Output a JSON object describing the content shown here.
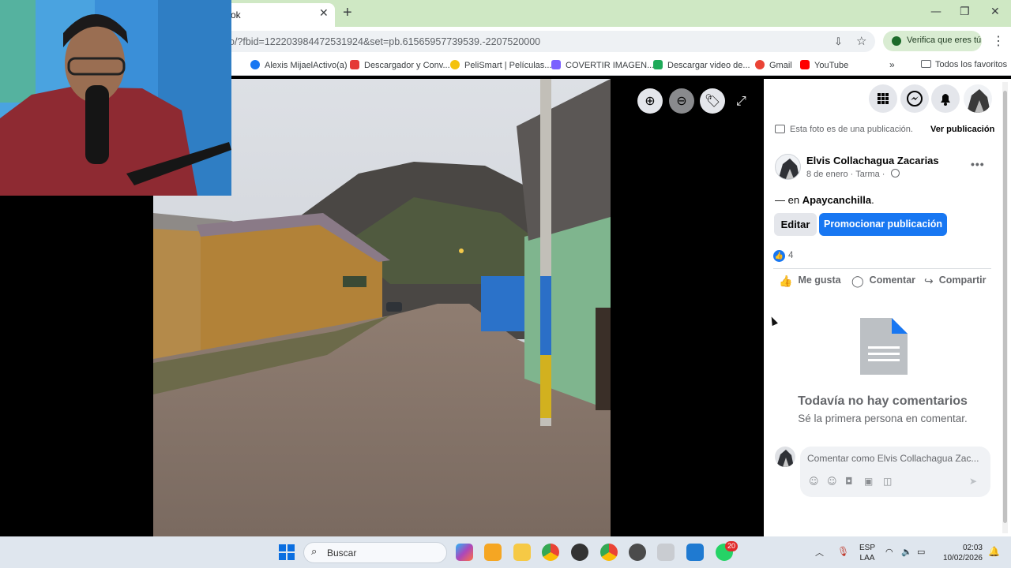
{
  "browser": {
    "tab_title": "ok",
    "tab_close": "✕",
    "new_tab": "+",
    "window_controls": [
      "—",
      "❐",
      "✕"
    ],
    "url": "o/?fbid=122203984472531924&set=pb.61565957739539.-2207520000",
    "verify_chip": "Verifica que eres tú",
    "menu": "⋮",
    "more_bookmarks": "»",
    "all_bookmarks": "Todos los favoritos",
    "bookmarks": [
      {
        "label": "Alexis MijaelActivo(a)",
        "color": "#1877f2"
      },
      {
        "label": "Descargador y Conv...",
        "color": "#e53935"
      },
      {
        "label": "PeliSmart | Películas...",
        "color": "#f4c20d"
      },
      {
        "label": "COVERTIR IMAGEN...",
        "color": "#7b61ff"
      },
      {
        "label": "Descargar video de...",
        "color": "#1faa59"
      },
      {
        "label": "Gmail",
        "color": "#ea4335"
      },
      {
        "label": "YouTube",
        "color": "#ff0000"
      }
    ]
  },
  "viewer": {
    "zoom_in": "⊕",
    "zoom_out": "⊖",
    "tag": "🏷",
    "expand": "⤢"
  },
  "post": {
    "info": "Esta foto es de una publicación.",
    "view_post": "Ver publicación",
    "author": "Elvis Collachagua Zacarias",
    "date": "8 de enero",
    "place_meta": "Tarma",
    "location_prefix": "— en ",
    "location": "Apaycanchilla",
    "location_suffix": ".",
    "edit": "Editar",
    "promote": "Promocionar publicación",
    "like_count": "4",
    "actions": {
      "like": "Me gusta",
      "comment": "Comentar",
      "share": "Compartir"
    },
    "no_comments": "Todavía no hay comentarios",
    "be_first": "Sé la primera persona en comentar.",
    "comment_placeholder": "Comentar como Elvis Collachagua Zac..."
  },
  "taskbar": {
    "search": "Buscar",
    "whatsapp_badge": "20",
    "lang_top": "ESP",
    "lang_bottom": "LAA",
    "time": "02:03",
    "date": "10/02/2026"
  }
}
